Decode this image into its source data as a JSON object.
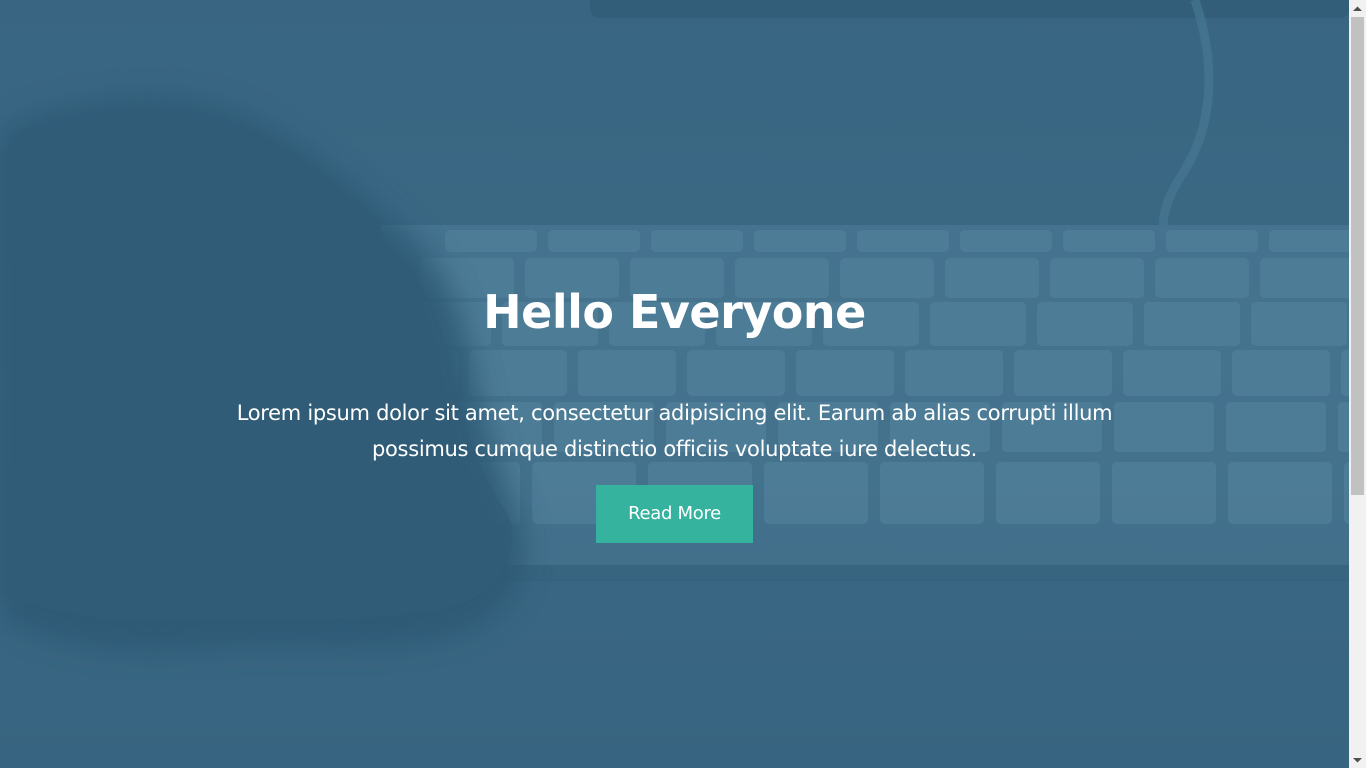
{
  "hero": {
    "title": "Hello Everyone",
    "text": "Lorem ipsum dolor sit amet, consectetur adipisicing elit. Earum ab alias corrupti illum possimus cumque distinctio officiis voluptate iure delectus.",
    "button_label": "Read More",
    "background_image": "hand-on-keyboard-photo"
  },
  "scrollbar": {
    "up_icon": "scroll-up-arrow-icon",
    "down_icon": "scroll-down-arrow-icon"
  },
  "colors": {
    "overlay": "#3f6e89",
    "button": "#35b39f",
    "text": "#ffffff",
    "scrollbar_track": "#f1f1f1",
    "scrollbar_thumb": "#c1c1c1"
  }
}
